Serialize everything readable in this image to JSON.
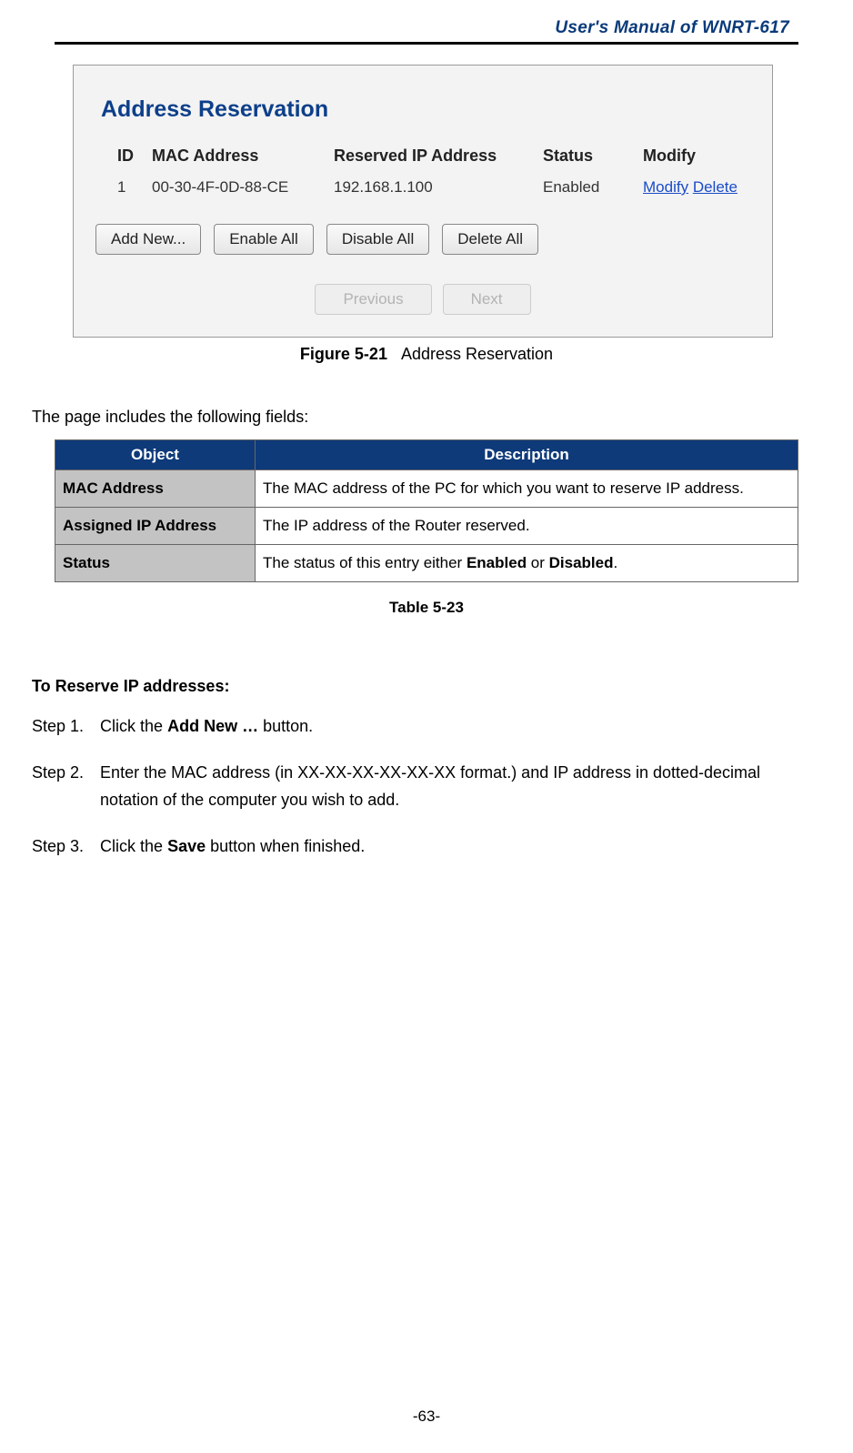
{
  "header": {
    "title": "User's  Manual  of  WNRT-617"
  },
  "screenshot": {
    "panel_title": "Address Reservation",
    "columns": {
      "id": "ID",
      "mac": "MAC Address",
      "ip": "Reserved IP Address",
      "status": "Status",
      "modify": "Modify"
    },
    "rows": [
      {
        "id": "1",
        "mac": "00-30-4F-0D-88-CE",
        "ip": "192.168.1.100",
        "status": "Enabled",
        "modify": "Modify",
        "delete": "Delete"
      }
    ],
    "buttons": {
      "add_new": "Add New...",
      "enable_all": "Enable All",
      "disable_all": "Disable All",
      "delete_all": "Delete All"
    },
    "nav": {
      "previous": "Previous",
      "next": "Next"
    }
  },
  "figure_caption": {
    "bold": "Figure 5-21",
    "rest": "Address Reservation"
  },
  "intro": "The page includes the following fields:",
  "desc_table": {
    "headers": {
      "object": "Object",
      "description": "Description"
    },
    "rows": [
      {
        "object": "MAC Address",
        "desc_plain": "The MAC address of the PC for which you want to reserve IP address."
      },
      {
        "object": "Assigned IP Address",
        "desc_plain": "The IP address of the Router reserved."
      },
      {
        "object": "Status",
        "desc_pre": "The status of this entry either ",
        "desc_b1": "Enabled",
        "desc_mid": " or ",
        "desc_b2": "Disabled",
        "desc_post": "."
      }
    ]
  },
  "desc_caption": "Table 5-23",
  "section": "To Reserve IP addresses:",
  "steps": {
    "s1": {
      "label": "Step 1.",
      "pre": "Click the ",
      "bold": "Add New …",
      "post": " button."
    },
    "s2": {
      "label": "Step 2.",
      "text": "Enter the MAC address (in XX-XX-XX-XX-XX-XX format.) and IP address in dotted-decimal notation of the computer you wish to add."
    },
    "s3": {
      "label": "Step 3.",
      "pre": "Click the ",
      "bold": "Save",
      "post": " button when finished."
    }
  },
  "page_number": "-63-"
}
